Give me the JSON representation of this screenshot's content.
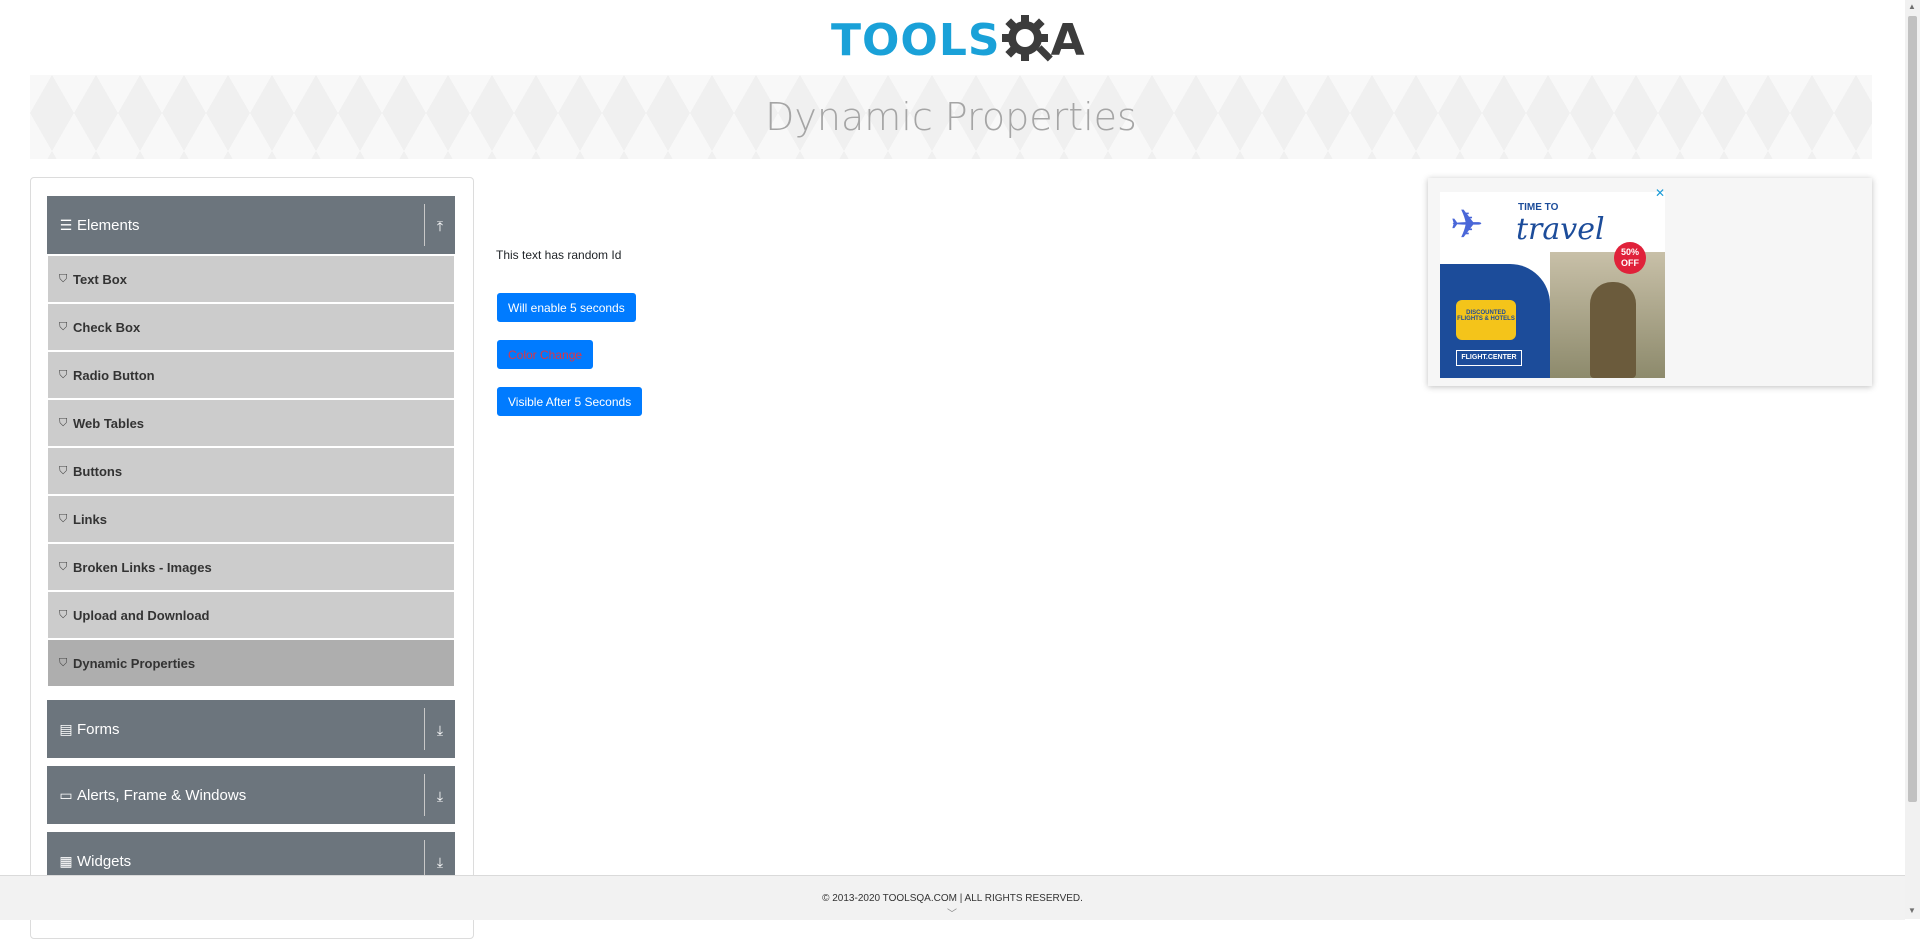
{
  "header": {
    "logo_text_main": "TOOLS",
    "logo_text_end": "A",
    "page_title": "Dynamic Properties"
  },
  "sidebar": {
    "groups": [
      {
        "title": "Elements",
        "icon": "hamburger-icon",
        "arrow": "collapse-up-icon",
        "expanded": true
      },
      {
        "title": "Forms",
        "icon": "form-icon",
        "arrow": "expand-down-icon",
        "expanded": false
      },
      {
        "title": "Alerts, Frame & Windows",
        "icon": "window-icon",
        "arrow": "expand-down-icon",
        "expanded": false
      },
      {
        "title": "Widgets",
        "icon": "grid-icon",
        "arrow": "expand-down-icon",
        "expanded": false
      }
    ],
    "items": [
      {
        "label": "Text Box",
        "icon": "shield-icon"
      },
      {
        "label": "Check Box",
        "icon": "shield-icon"
      },
      {
        "label": "Radio Button",
        "icon": "shield-icon"
      },
      {
        "label": "Web Tables",
        "icon": "shield-icon"
      },
      {
        "label": "Buttons",
        "icon": "shield-icon"
      },
      {
        "label": "Links",
        "icon": "shield-icon"
      },
      {
        "label": "Broken Links - Images",
        "icon": "shield-icon"
      },
      {
        "label": "Upload and Download",
        "icon": "shield-icon"
      },
      {
        "label": "Dynamic Properties",
        "icon": "shield-icon",
        "active": true
      }
    ]
  },
  "main": {
    "random_id_text": "This text has random Id",
    "enable_after_button": "Will enable 5 seconds",
    "color_change_button": "Color Change",
    "visible_after_button": "Visible After 5 Seconds"
  },
  "ad": {
    "close": "✕",
    "time_to": "TIME TO",
    "travel": "travel",
    "badge": "50% OFF",
    "discount": "DISCOUNTED FLIGHTS & HOTELS",
    "brand": "FLIGHT.CENTER"
  },
  "footer": {
    "copyright": "© 2013-2020 TOOLSQA.COM | ALL RIGHTS RESERVED."
  },
  "colors": {
    "accent": "#007bff",
    "group_header": "#6c757d",
    "menu_item": "#cccccc",
    "menu_item_active": "#aeaeae",
    "logo_blue": "#1aa1d8",
    "color_change_text": "#dc3545"
  }
}
